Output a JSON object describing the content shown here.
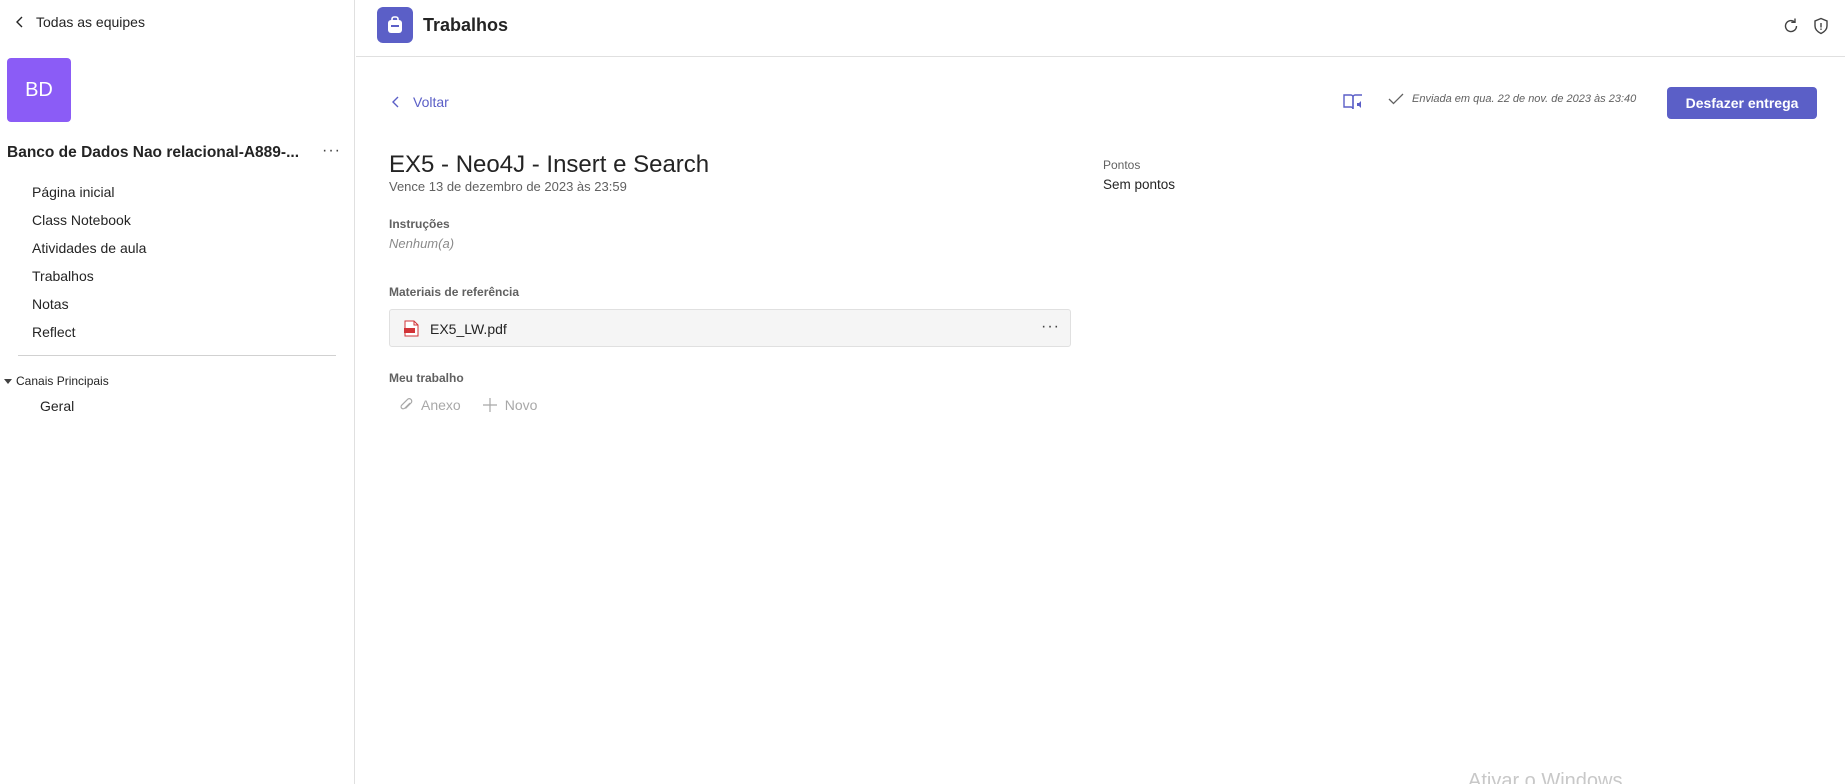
{
  "sidebar": {
    "back_label": "Todas as equipes",
    "team_initials": "BD",
    "team_name": "Banco de Dados Nao relacional-A889-...",
    "more_label": "···",
    "items": [
      {
        "label": "Página inicial"
      },
      {
        "label": "Class Notebook"
      },
      {
        "label": "Atividades de aula"
      },
      {
        "label": "Trabalhos"
      },
      {
        "label": "Notas"
      },
      {
        "label": "Reflect"
      }
    ],
    "channels_header": "Canais Principais",
    "channels": [
      {
        "label": "Geral"
      }
    ]
  },
  "header": {
    "app_title": "Trabalhos",
    "icons": [
      "refresh-icon",
      "shield-icon"
    ]
  },
  "assignment": {
    "back_label": "Voltar",
    "submitted_text": "Enviada em qua. 22 de nov. de 2023 às 23:40",
    "undo_button": "Desfazer entrega",
    "title": "EX5 - Neo4J - Insert e Search",
    "due": "Vence 13 de dezembro de 2023 às 23:59",
    "points_label": "Pontos",
    "points_value": "Sem pontos",
    "instructions_label": "Instruções",
    "instructions_value": "Nenhum(a)",
    "reference_label": "Materiais de referência",
    "reference_file": "EX5_LW.pdf",
    "file_more": "···",
    "my_work_label": "Meu trabalho",
    "attach_label": "Anexo",
    "new_label": "Novo"
  },
  "watermark": "Ativar o Windows",
  "colors": {
    "accent": "#5b5fc7",
    "team_avatar": "#8b5cf6",
    "pdf_red": "#d13438"
  }
}
